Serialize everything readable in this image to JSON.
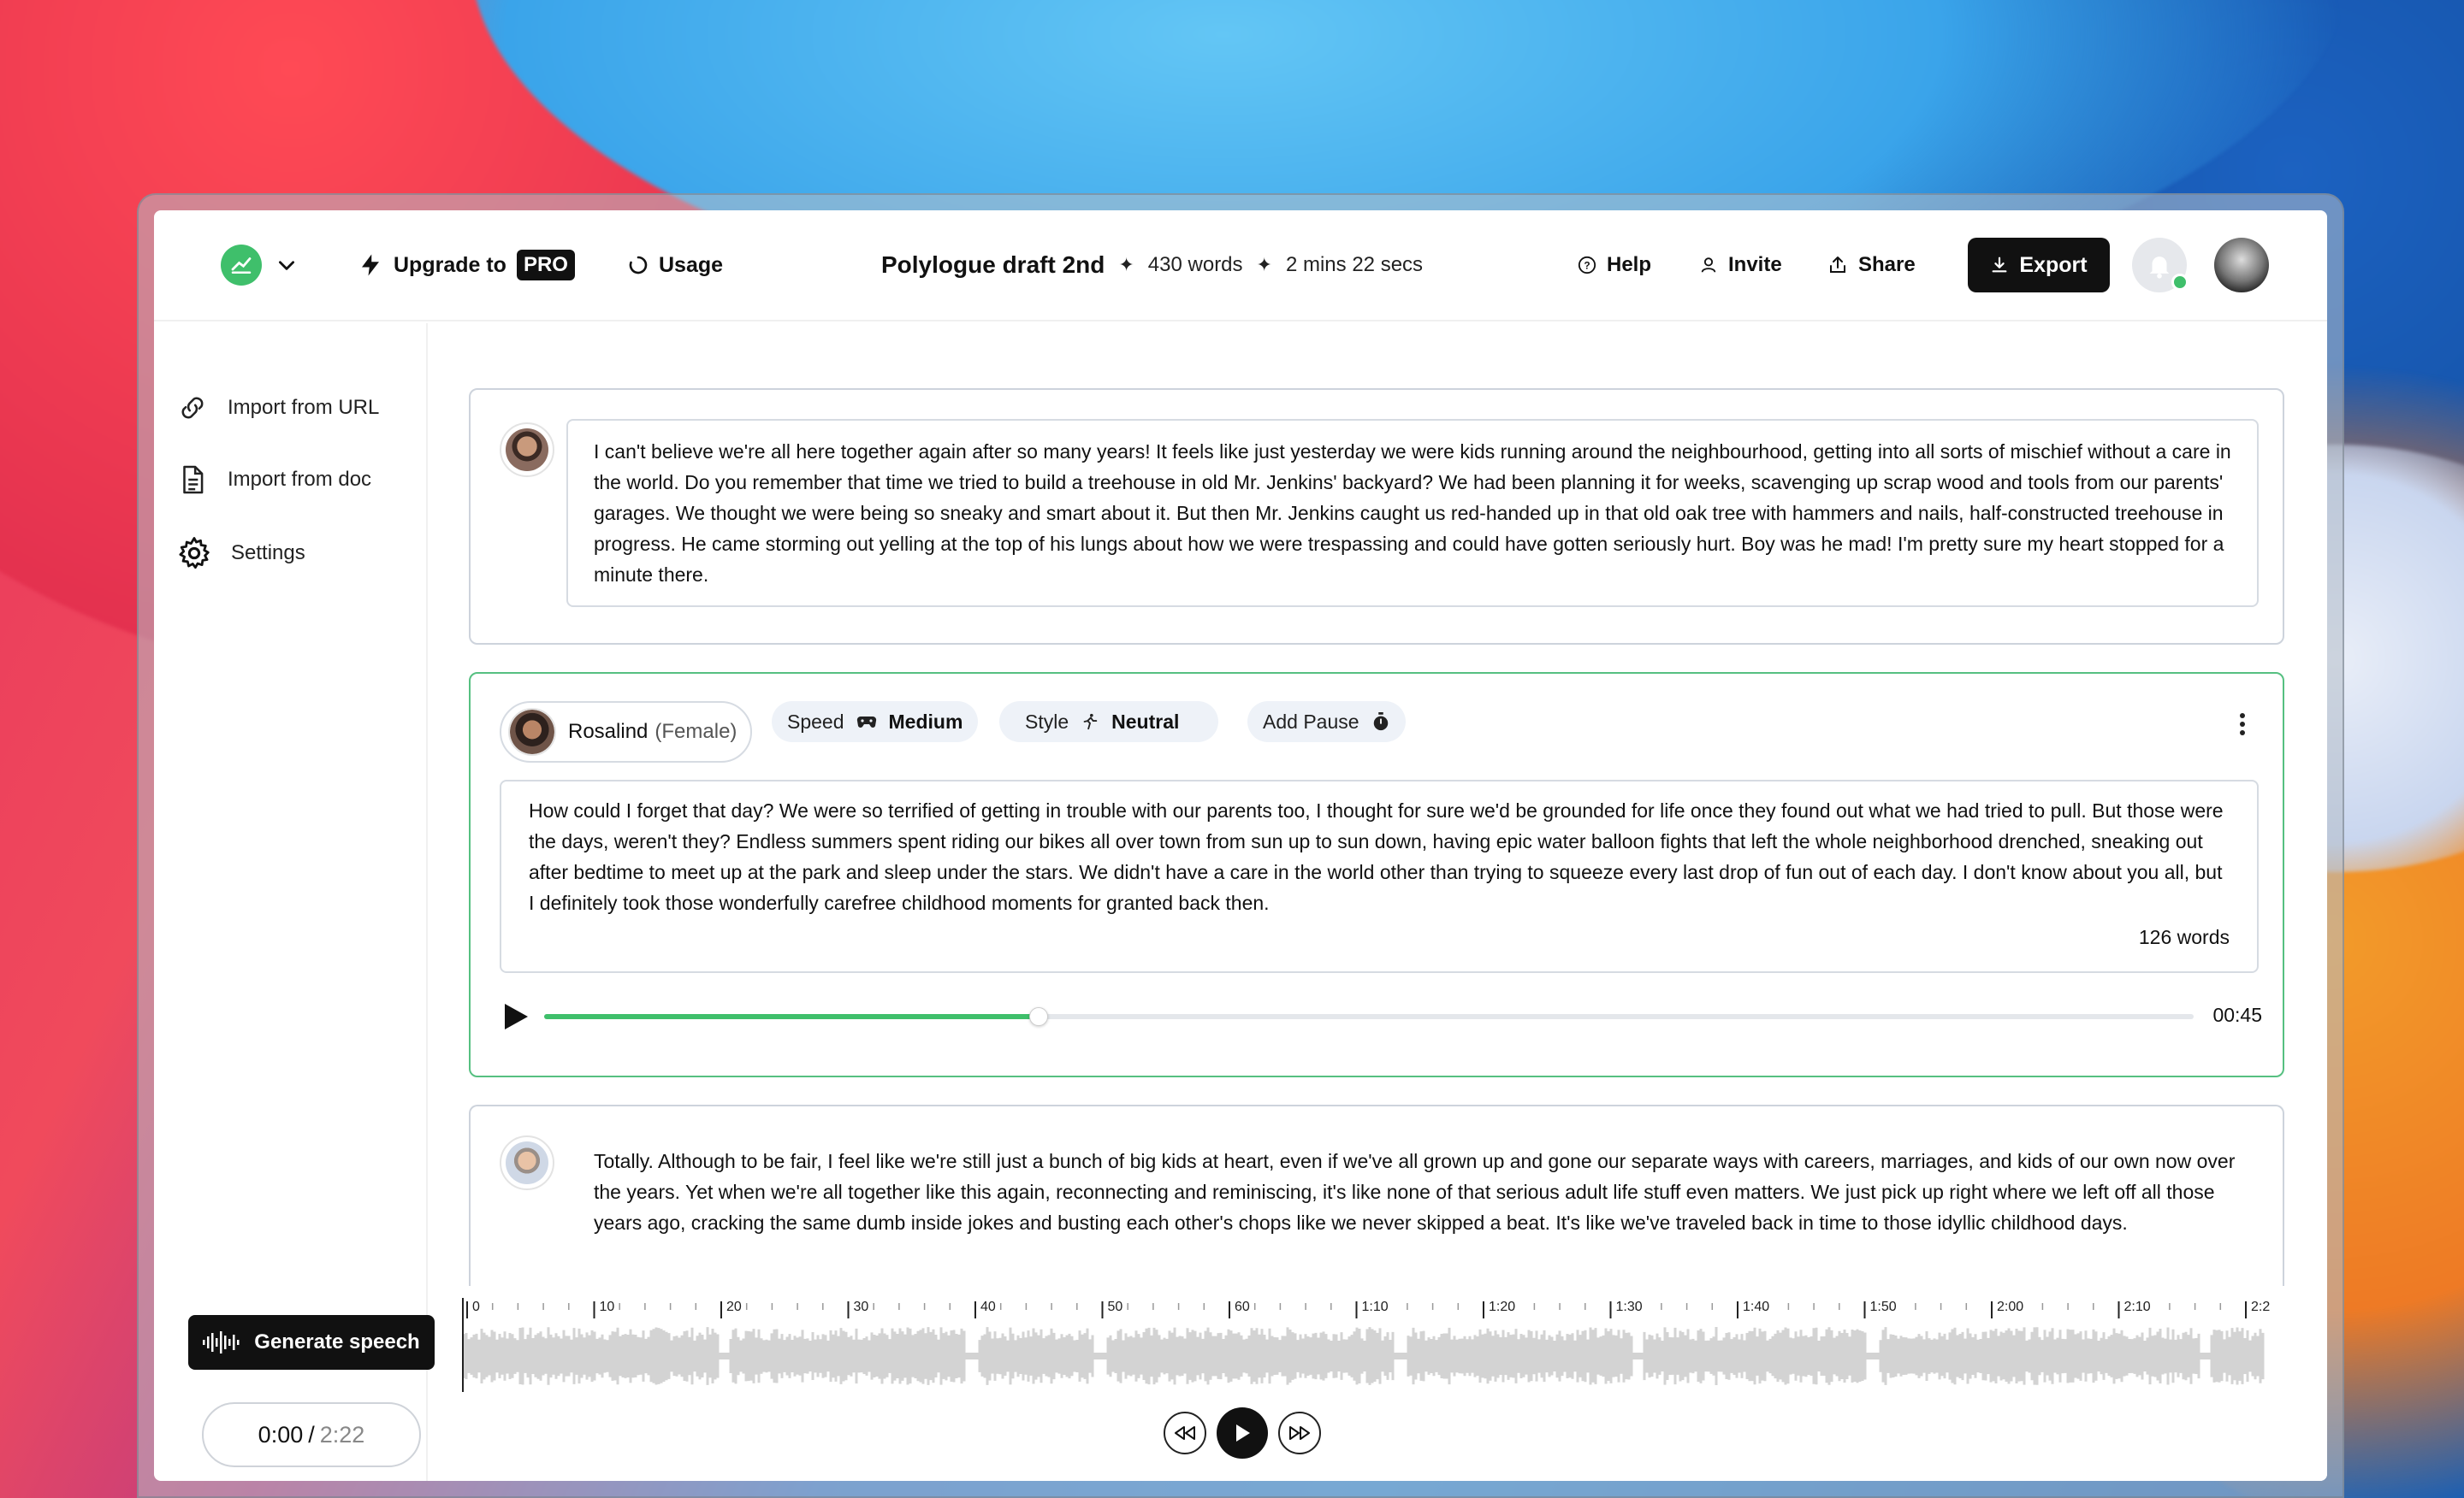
{
  "header": {
    "upgrade_label": "Upgrade to",
    "pro_label": "PRO",
    "usage_label": "Usage",
    "doc_title": "Polylogue draft 2nd",
    "word_count": "430 words",
    "duration": "2 mins 22 secs",
    "help_label": "Help",
    "invite_label": "Invite",
    "share_label": "Share",
    "export_label": "Export"
  },
  "sidebar": {
    "items": [
      {
        "label": "Import from URL",
        "icon": "link-icon"
      },
      {
        "label": "Import from doc",
        "icon": "document-icon"
      },
      {
        "label": "Settings",
        "icon": "gear-icon"
      }
    ]
  },
  "blocks": [
    {
      "text": "I can't believe we're all here together again after so many years! It feels like just yesterday we were kids running around the neighbourhood, getting into all sorts of mischief without a care in the world. Do you remember that time we tried to build a treehouse in old Mr. Jenkins' backyard? We had been planning it for weeks, scavenging up scrap wood and tools from our parents' garages. We thought we were being so sneaky and smart about it. But then Mr. Jenkins caught us red-handed up in that old oak tree with hammers and nails, half-constructed treehouse in progress. He came storming out yelling at the top of his lungs about how we were trespassing and could have gotten seriously hurt. Boy was he mad! I'm pretty sure my heart stopped for a minute there."
    },
    {
      "voice_name": "Rosalind",
      "voice_gender": "(Female)",
      "speed_label": "Speed",
      "speed_value": "Medium",
      "style_label": "Style",
      "style_value": "Neutral",
      "pause_label": "Add Pause",
      "text": "How could I forget that day? We were so terrified of getting in trouble with our parents too, I thought for sure we'd be grounded for life once they found out what we had tried to pull. But those were the days, weren't they? Endless summers spent riding our bikes all over town from sun up to sun down, having epic water balloon fights that left the whole neighborhood drenched, sneaking out after bedtime to meet up at the park and sleep under the stars. We didn't have a care in the world other than trying to squeeze every last drop of fun out of each day. I don't know about you all, but I definitely took those wonderfully carefree childhood moments for granted back then.",
      "word_count": "126 words",
      "time": "00:45",
      "progress": 0.3
    },
    {
      "text": "Totally. Although to be fair, I feel like we're still just a bunch of big kids at heart, even if we've all grown up and gone our separate ways with careers, marriages, and kids of our own now over the years. Yet when we're all together like this again, reconnecting and reminiscing, it's like none of that serious adult life stuff even matters. We just pick up right where we left off all those years ago, cracking the same dumb inside jokes and busting each other's chops like we never skipped a beat. It's like we've traveled back in time to those idyllic childhood days."
    }
  ],
  "bottom": {
    "generate_label": "Generate speech",
    "current_time": "0:00",
    "separator": "/",
    "total_time": "2:22",
    "ticks": [
      "0",
      "10",
      "20",
      "30",
      "40",
      "50",
      "60",
      "1:10",
      "1:20",
      "1:30",
      "1:40",
      "1:50",
      "2:00",
      "2:10",
      "2:2"
    ]
  },
  "colors": {
    "accent": "#3fbf6b",
    "dark": "#111111"
  }
}
